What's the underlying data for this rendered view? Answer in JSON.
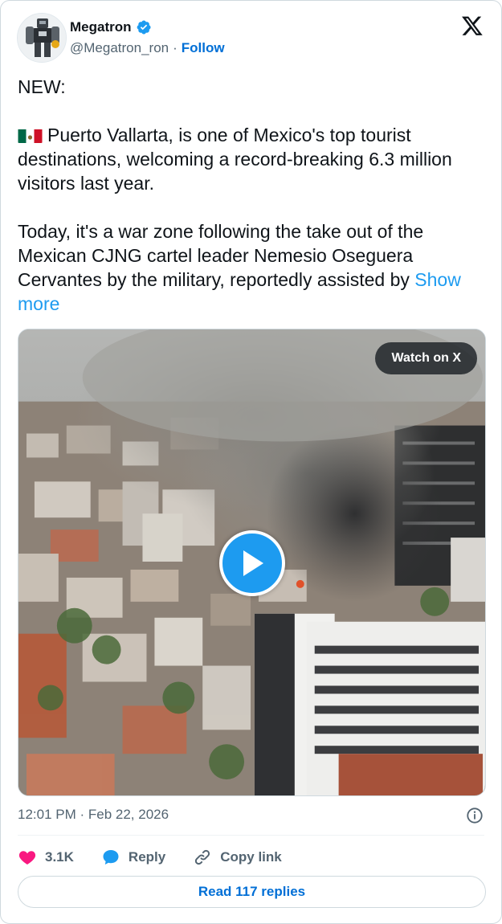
{
  "author": {
    "display_name": "Megatron",
    "handle": "@Megatron_ron",
    "separator": "·",
    "follow_label": "Follow",
    "verified": true
  },
  "tweet": {
    "line1": "NEW:",
    "paragraph2": "Puerto Vallarta, is one of Mexico's top tourist destinations,  welcoming a record-breaking 6.3 million visitors last year.",
    "paragraph3": "Today, it's a war zone following the take out of the Mexican CJNG cartel leader Nemesio Oseguera Cervantes by the military, reportedly assisted by",
    "show_more_label": "Show more"
  },
  "media": {
    "watch_label": "Watch on X",
    "play_icon": "play-icon"
  },
  "meta": {
    "timestamp": "12:01 PM · Feb 22, 2026"
  },
  "actions": {
    "likes_count": "3.1K",
    "reply_label": "Reply",
    "copy_link_label": "Copy link"
  },
  "read_replies_label": "Read 117 replies",
  "colors": {
    "link_blue": "#006fd6",
    "accent_blue": "#1d9bf0",
    "heart_pink": "#f91880",
    "muted_text": "#536471",
    "border": "#cfd9de"
  }
}
